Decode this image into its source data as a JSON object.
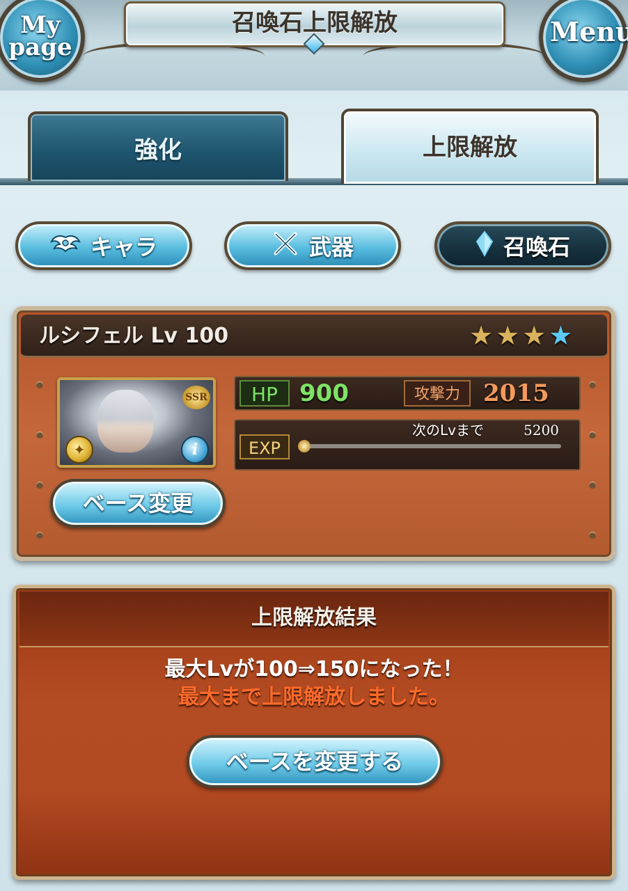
{
  "header": {
    "title": "召喚石上限解放",
    "mypage_label_line1": "My",
    "mypage_label_line2": "page",
    "menu_label": "Menu"
  },
  "tabs": [
    {
      "label": "強化",
      "active": false
    },
    {
      "label": "上限解放",
      "active": true
    }
  ],
  "categories": [
    {
      "label": "キャラ",
      "icon": "wing-emblem-icon",
      "active": false
    },
    {
      "label": "武器",
      "icon": "crossed-swords-icon",
      "active": false
    },
    {
      "label": "召喚石",
      "icon": "crystal-icon",
      "active": true
    }
  ],
  "summon": {
    "name": "ルシフェル Lv 100",
    "rarity_badge": "SSR",
    "uncap_stars_total": 4,
    "uncap_stars_gold": 3,
    "hp_label": "HP",
    "hp": "900",
    "atk_label": "攻撃力",
    "atk": "2015",
    "exp_label": "EXP",
    "next_lv_label": "次のLvまで",
    "next_lv_value": "5200",
    "exp_progress": 0,
    "base_change_label": "ベース変更"
  },
  "result": {
    "title": "上限解放結果",
    "message_line1": "最大Lvが100⇒150になった！",
    "message_line2": "最大まで上限解放しました。",
    "button_label": "ベースを変更する"
  },
  "colors": {
    "hp_green": "#7ee266",
    "atk_orange": "#f49a5c",
    "result_highlight": "#ff6a2a",
    "panel_brown": "#b5542a",
    "button_blue": "#59bde0"
  }
}
